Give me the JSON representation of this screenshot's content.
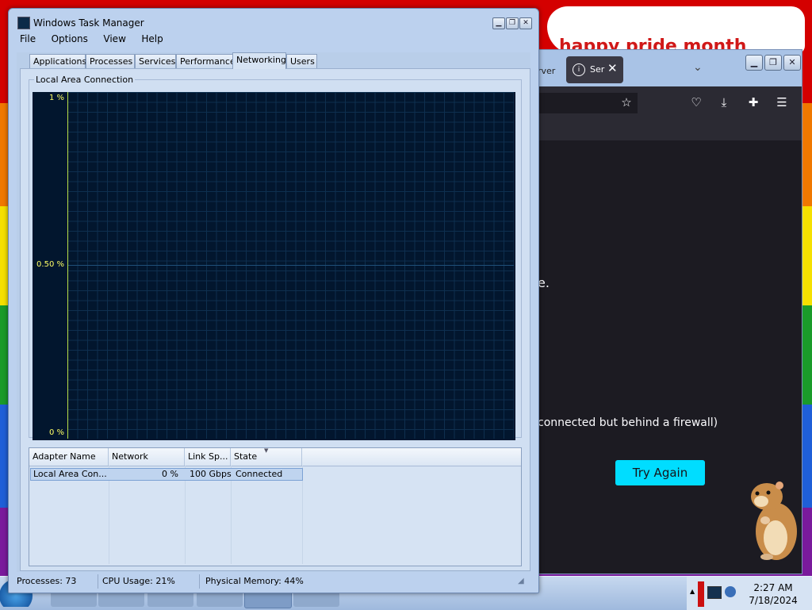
{
  "desktop": {
    "banner_text": "happy pride month"
  },
  "firefox": {
    "tab_behind_label": "rver",
    "active_tab_label": "Ser",
    "message": "connected but behind a firewall)",
    "dot_text": "e.",
    "try_again_label": "Try Again"
  },
  "taskbar": {
    "time": "2:27 AM",
    "date": "7/18/2024"
  },
  "task_manager": {
    "title": "Windows Task Manager",
    "menu": [
      "File",
      "Options",
      "View",
      "Help"
    ],
    "tabs": [
      "Applications",
      "Processes",
      "Services",
      "Performance",
      "Networking",
      "Users"
    ],
    "active_tab": "Networking",
    "graph": {
      "group_label": "Local Area Connection",
      "y_labels": [
        "1 %",
        "0.50 %",
        "0 %"
      ],
      "line_color": "#b8e04a",
      "label_color": "#ffff66"
    },
    "adapters": {
      "columns": [
        "Adapter Name",
        "Network Utiliza...",
        "Link Sp...",
        "State"
      ],
      "rows": [
        {
          "name": "Local Area Con...",
          "utilization": "0 %",
          "link_speed": "100 Gbps",
          "state": "Connected"
        }
      ]
    },
    "status": {
      "processes": "Processes: 73",
      "cpu": "CPU Usage: 21%",
      "memory": "Physical Memory: 44%"
    }
  }
}
